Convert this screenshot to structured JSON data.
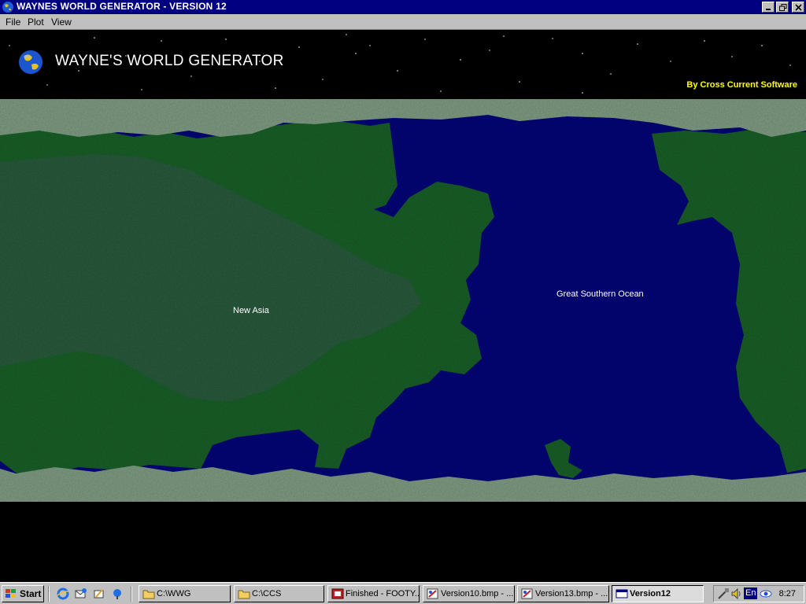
{
  "window": {
    "title": "WAYNES WORLD GENERATOR - VERSION 12"
  },
  "menu": [
    "File",
    "Plot",
    "View"
  ],
  "banner": {
    "heading": "WAYNE'S WORLD GENERATOR",
    "credit": "By Cross Current Software"
  },
  "map": {
    "labels": {
      "continent": "New Asia",
      "ocean": "Great Southern Ocean"
    },
    "colors": {
      "ocean": "#02046c",
      "land": "#1f5e2a",
      "land_highland": "#2c5a3e",
      "ice": "#7e9a82"
    }
  },
  "taskbar": {
    "start_label": "Start",
    "quick_launch": [
      "internet-explorer-icon",
      "outlook-express-icon",
      "show-desktop-icon",
      "channels-icon"
    ],
    "tasks": [
      {
        "label": "C:\\WWG",
        "icon": "folder-icon"
      },
      {
        "label": "C:\\CCS",
        "icon": "folder-icon"
      },
      {
        "label": "Finished - FOOTY...",
        "icon": "app-icon"
      },
      {
        "label": "Version10.bmp - ...",
        "icon": "paint-icon"
      },
      {
        "label": "Version13.bmp - ...",
        "icon": "paint-icon"
      },
      {
        "label": "Version12",
        "icon": "window-icon",
        "active": true
      }
    ],
    "tray": {
      "language": "En",
      "clock": "8:27"
    }
  }
}
